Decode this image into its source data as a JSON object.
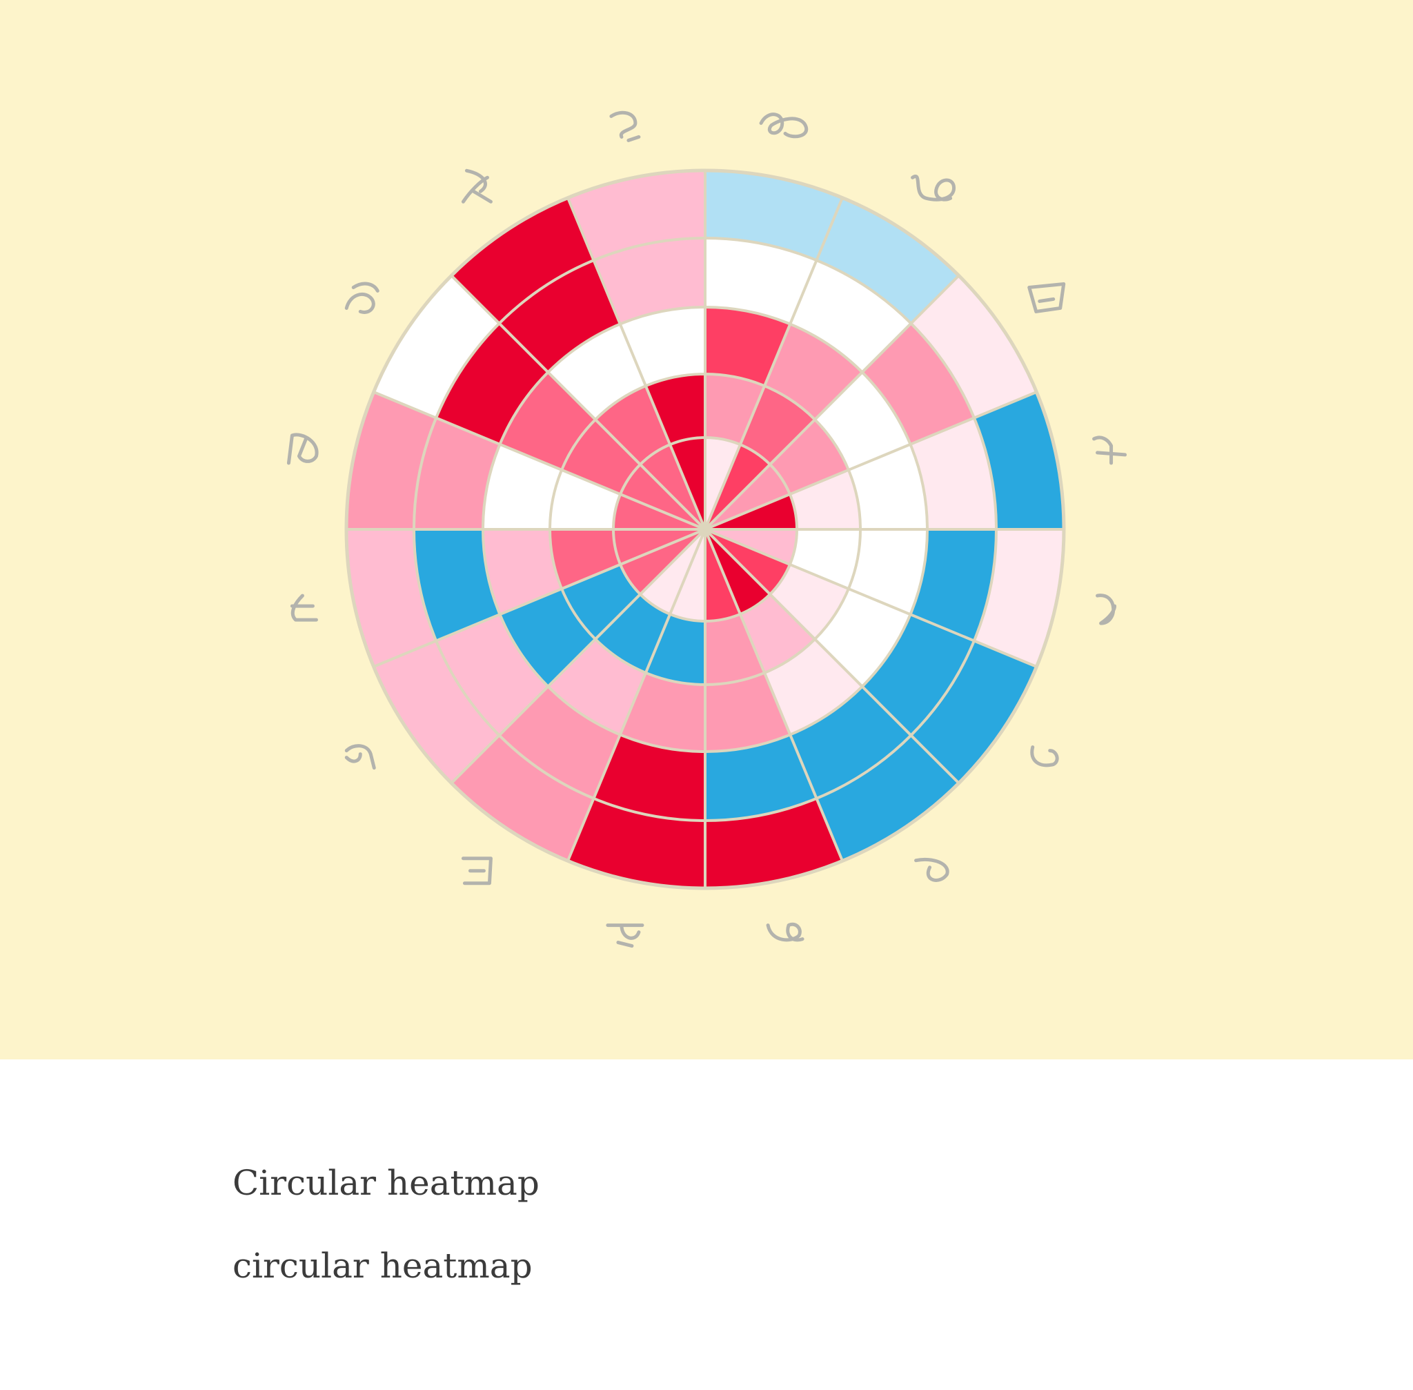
{
  "colors": {
    "background": "#fdf4cb",
    "grid_line": "#ddd6bd",
    "label": "#b3b3ad",
    "caption": "#3b3b3b"
  },
  "captions": {
    "title": "Circular heatmap",
    "subtitle": "circular heatmap"
  },
  "chart_data": {
    "type": "heatmap",
    "layout": "circular",
    "title": "",
    "sectors": [
      "glyph-01",
      "glyph-02",
      "glyph-03",
      "glyph-04",
      "glyph-05",
      "glyph-06",
      "glyph-07",
      "glyph-08",
      "glyph-09",
      "glyph-10",
      "glyph-11",
      "glyph-12",
      "glyph-13",
      "glyph-14",
      "glyph-15",
      "glyph-16"
    ],
    "sector_labels_are_handwritten_glyphs": true,
    "rings": 5,
    "value_range": [
      -3,
      3
    ],
    "color_scale": [
      "#29a8df",
      "#b1e0f4",
      "#eaf6fd",
      "#ffffff",
      "#ffe9ef",
      "#ffbcd1",
      "#fe9ab2",
      "#fe6686",
      "#fe3f64",
      "#e9002f"
    ],
    "values": [
      [
        -0.5,
        0.7,
        2.1,
        -1.0,
        -2.0
      ],
      [
        2.2,
        1.8,
        0.8,
        -1.0,
        -2.0
      ],
      [
        0.8,
        1.0,
        -1.1,
        0.8,
        -0.5
      ],
      [
        2.5,
        -0.5,
        -1.0,
        -0.5,
        -3.0
      ],
      [
        0.0,
        -1.0,
        -1.0,
        -3.0,
        -0.5
      ],
      [
        2.1,
        -0.5,
        -1.0,
        -3.0,
        -3.0
      ],
      [
        2.5,
        0.5,
        -0.5,
        -3.0,
        -3.0
      ],
      [
        2.1,
        0.8,
        0.8,
        -3.0,
        3.0
      ],
      [
        -0.5,
        -3.0,
        0.8,
        3.0,
        3.0
      ],
      [
        -0.5,
        -3.0,
        0.0,
        0.8,
        0.8
      ],
      [
        1.3,
        -3.0,
        -3.0,
        0.0,
        0.0
      ],
      [
        1.3,
        1.3,
        0.0,
        -3.0,
        0.0
      ],
      [
        1.3,
        -1.0,
        -1.0,
        0.8,
        0.8
      ],
      [
        1.3,
        1.3,
        1.3,
        3.0,
        -1.0
      ],
      [
        1.3,
        1.3,
        -1.0,
        2.5,
        3.0
      ],
      [
        2.5,
        2.5,
        -1.0,
        0.0,
        0.2
      ]
    ]
  }
}
